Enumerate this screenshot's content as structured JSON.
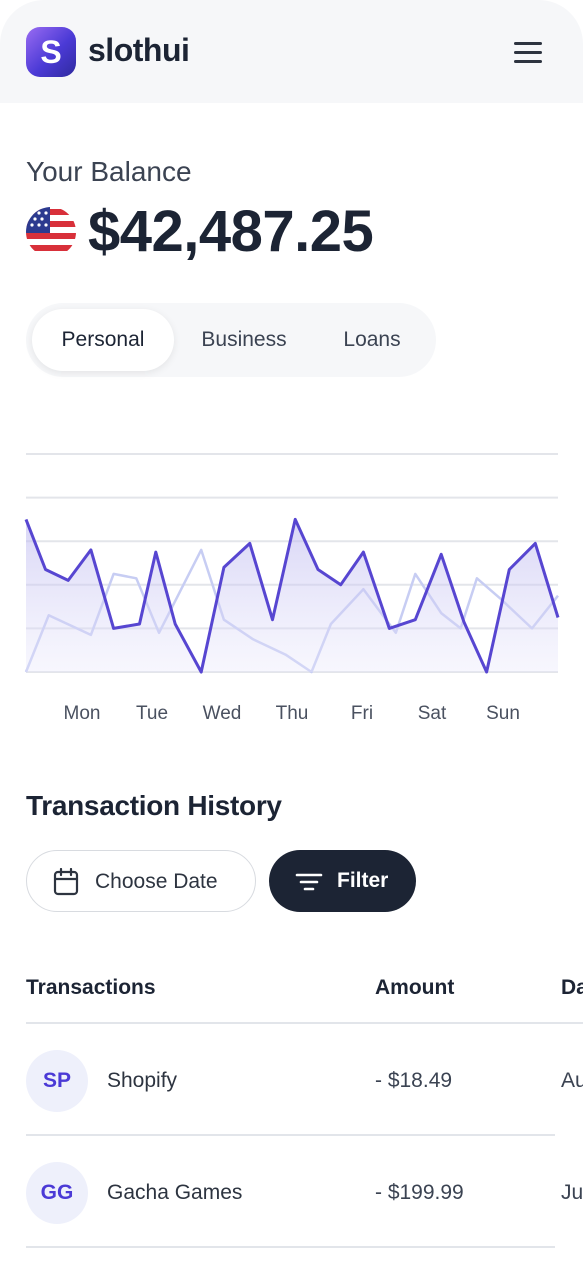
{
  "app": {
    "logo_letter": "S",
    "name": "slothui"
  },
  "balance": {
    "label": "Your Balance",
    "value": "$42,487.25"
  },
  "tabs": [
    {
      "label": "Personal",
      "active": true
    },
    {
      "label": "Business",
      "active": false
    },
    {
      "label": "Loans",
      "active": false
    }
  ],
  "chart_data": {
    "type": "line",
    "categories": [
      "Mon",
      "Tue",
      "Wed",
      "Thu",
      "Fri",
      "Sat",
      "Sun"
    ],
    "series": [
      {
        "color": "#5746d1",
        "points": [
          [
            0,
            70
          ],
          [
            0.3,
            47
          ],
          [
            0.65,
            42
          ],
          [
            1,
            56
          ],
          [
            1.35,
            20
          ],
          [
            1.75,
            22
          ],
          [
            2,
            55
          ],
          [
            2.3,
            22
          ],
          [
            2.7,
            0
          ],
          [
            3.05,
            48
          ],
          [
            3.45,
            59
          ],
          [
            3.8,
            24
          ],
          [
            4.15,
            70
          ],
          [
            4.5,
            47
          ],
          [
            4.85,
            40
          ],
          [
            5.2,
            55
          ],
          [
            5.6,
            20
          ],
          [
            6,
            24
          ],
          [
            6.4,
            54
          ],
          [
            6.75,
            23
          ],
          [
            7.1,
            0
          ],
          [
            7.45,
            47
          ],
          [
            7.85,
            59
          ],
          [
            8.2,
            25
          ]
        ]
      },
      {
        "color": "#c7cdf3",
        "points": [
          [
            0,
            0
          ],
          [
            0.35,
            26
          ],
          [
            1,
            17
          ],
          [
            1.35,
            45
          ],
          [
            1.7,
            43
          ],
          [
            2.05,
            18
          ],
          [
            2.7,
            56
          ],
          [
            3.05,
            24
          ],
          [
            3.5,
            15
          ],
          [
            4.0,
            8
          ],
          [
            4.4,
            0
          ],
          [
            4.7,
            22
          ],
          [
            5.2,
            38
          ],
          [
            5.7,
            18
          ],
          [
            6.0,
            45
          ],
          [
            6.4,
            27
          ],
          [
            6.7,
            20
          ],
          [
            6.95,
            43
          ],
          [
            7.3,
            34
          ],
          [
            7.8,
            20
          ],
          [
            8.2,
            35
          ]
        ]
      }
    ],
    "ylim": [
      0,
      100
    ],
    "grid": true
  },
  "history": {
    "title": "Transaction History",
    "date_button": "Choose Date",
    "filter_button": "Filter"
  },
  "table": {
    "headers": [
      "Transactions",
      "Amount",
      "Da"
    ],
    "rows": [
      {
        "initials": "SP",
        "name": "Shopify",
        "amount": "- $18.49",
        "date": "Au"
      },
      {
        "initials": "GG",
        "name": "Gacha Games",
        "amount": "- $199.99",
        "date": "Ju"
      }
    ]
  },
  "colors": {
    "accent": "#4b3ad6",
    "dark": "#1c2434"
  },
  "icons": [
    "hamburger-menu-icon",
    "us-flag-icon",
    "calendar-icon",
    "filter-icon"
  ]
}
